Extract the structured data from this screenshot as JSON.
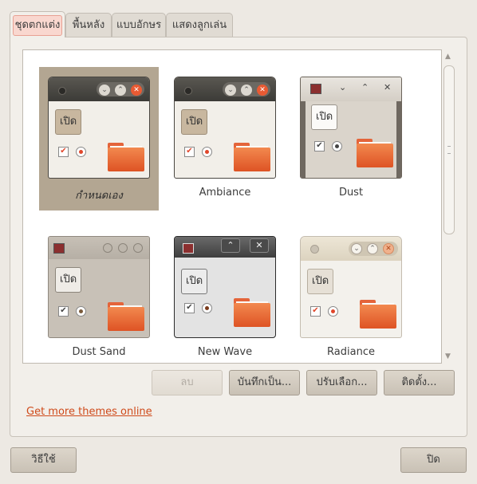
{
  "tabs": [
    {
      "label": "ชุดตกแต่ง"
    },
    {
      "label": "พื้นหลัง"
    },
    {
      "label": "แบบอักษร"
    },
    {
      "label": "แสดงลูกเล่น"
    }
  ],
  "themes": [
    {
      "name": "กำหนดเอง",
      "preview_button": "เปิด"
    },
    {
      "name": "Ambiance",
      "preview_button": "เปิด"
    },
    {
      "name": "Dust",
      "preview_button": "เปิด"
    },
    {
      "name": "Dust Sand",
      "preview_button": "เปิด"
    },
    {
      "name": "New Wave",
      "preview_button": "เปิด"
    },
    {
      "name": "Radiance",
      "preview_button": "เปิด"
    }
  ],
  "actions": {
    "delete_label": "ลบ",
    "save_as_label": "บันทึกเป็น...",
    "customize_label": "ปรับเลือก...",
    "install_label": "ติดตั้ง..."
  },
  "link_text": "Get more themes online",
  "footer": {
    "help_label": "วิธีใช้",
    "close_label": "ปิด"
  },
  "colors": {
    "accent": "#cf4a1a",
    "selection": "#b3a692",
    "folder_orange": "#e4643a"
  },
  "scrollbar": {
    "up": "▲",
    "down": "▼"
  },
  "icons": {
    "checkbox_mark": "✔",
    "close": "✕",
    "minimize": "⌄",
    "maximize": "⌃"
  }
}
